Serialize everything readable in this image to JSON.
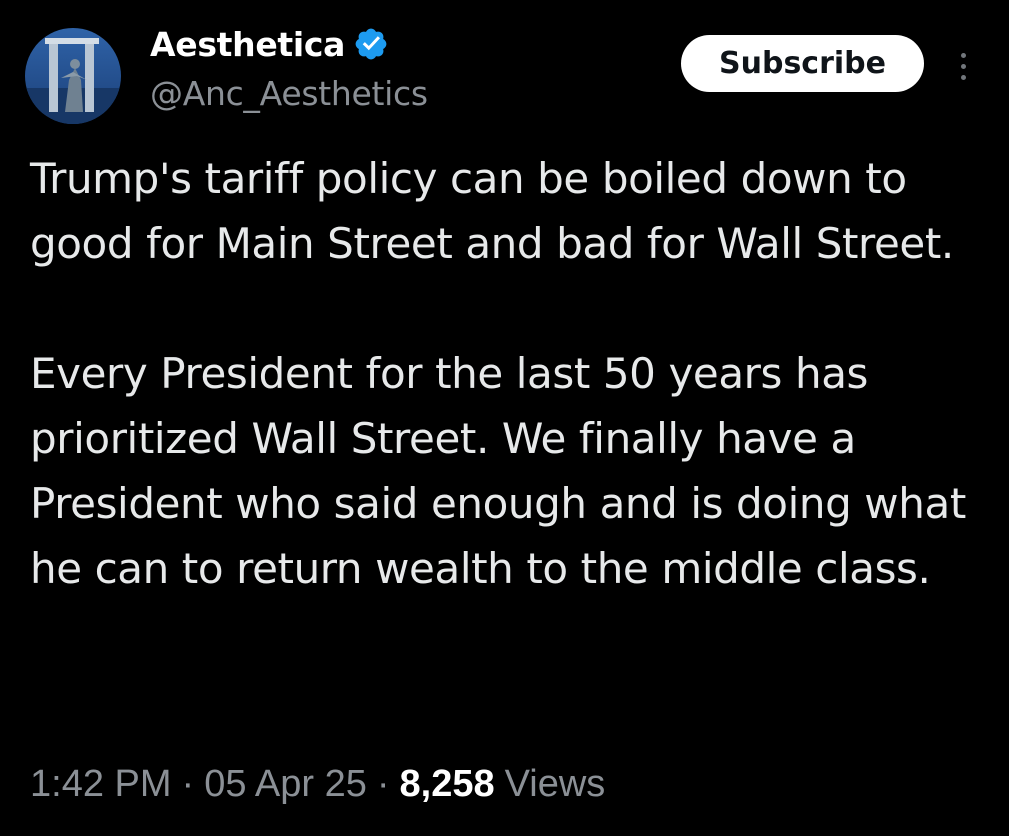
{
  "author": {
    "display_name": "Aesthetica",
    "handle": "@Anc_Aesthetics",
    "verified": true,
    "avatar_icon": "statue-avatar"
  },
  "actions": {
    "subscribe_label": "Subscribe",
    "more_icon": "more-vertical-icon"
  },
  "tweet": {
    "paragraphs": [
      "Trump's tariff policy can be boiled down to good for Main Street and bad for Wall Street.",
      "Every President for the last 50 years has prioritized Wall Street. We finally have a President who said enough and is doing what he can to return wealth to the middle class."
    ],
    "time": "1:42 PM",
    "separator": "·",
    "date": "05 Apr 25",
    "views_count": "8,258",
    "views_label": "Views"
  },
  "colors": {
    "background": "#000000",
    "primary_text": "#e7e9ea",
    "secondary_text": "#8b9096",
    "verified_badge": "#1d9bf0",
    "subscribe_bg": "#ffffff"
  }
}
